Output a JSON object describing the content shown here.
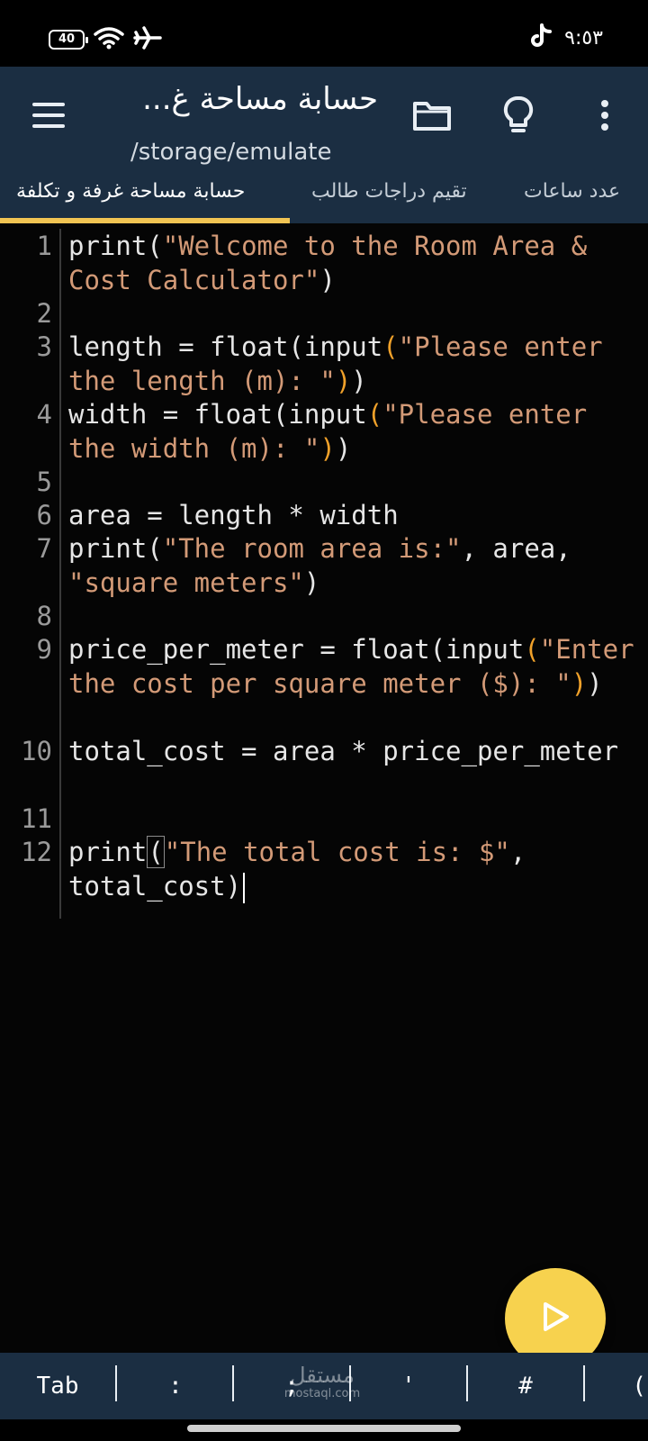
{
  "status_bar": {
    "battery": "40",
    "time": "٩:٥٣",
    "icons": [
      "wifi-icon",
      "airplane-icon",
      "tiktok-icon"
    ]
  },
  "app_bar": {
    "title": "حسابة مساحة غ...",
    "subtitle": "/storage/emulate",
    "icons": [
      "menu-icon",
      "folder-icon",
      "lightbulb-icon",
      "more-vert-icon"
    ]
  },
  "tabs": [
    {
      "label": "حسابة مساحة غرفة و تكلفة",
      "active": true
    },
    {
      "label": "تقيم دراجات طالب",
      "active": false
    },
    {
      "label": "عدد ساعات",
      "active": false
    }
  ],
  "editor": {
    "lines": [
      {
        "n": "1",
        "code": "print(\"Welcome to the Room Area & Cost Calculator\")"
      },
      {
        "n": "2",
        "code": ""
      },
      {
        "n": "3",
        "code": "length = float(input(\"Please enter the length (m): \"))"
      },
      {
        "n": "4",
        "code": "width = float(input(\"Please enter the width (m): \"))"
      },
      {
        "n": "5",
        "code": ""
      },
      {
        "n": "6",
        "code": "area = length * width"
      },
      {
        "n": "7",
        "code": "print(\"The room area is:\", area, \"square meters\")"
      },
      {
        "n": "8",
        "code": ""
      },
      {
        "n": "9",
        "code": "price_per_meter = float(input(\"Enter the cost per square meter ($): \"))"
      },
      {
        "n": "10",
        "code": "total_cost = area * price_per_meter"
      },
      {
        "n": "11",
        "code": ""
      },
      {
        "n": "12",
        "code": "print(\"The total cost is: $\", total_cost)"
      }
    ]
  },
  "fab": {
    "icon": "play-icon",
    "color": "#f7d24e"
  },
  "keyboard_bar": {
    "keys": [
      "Tab",
      ":",
      ";",
      "'",
      "#",
      "("
    ]
  },
  "watermark": {
    "arabic": "مستقل",
    "latin": "mostaql.com"
  },
  "colors": {
    "app_bar_bg": "#1b2e42",
    "tab_indicator": "#f1c453",
    "string": "#d39a77",
    "paren_highlight": "#f0a12a",
    "editor_bg": "#050505"
  }
}
